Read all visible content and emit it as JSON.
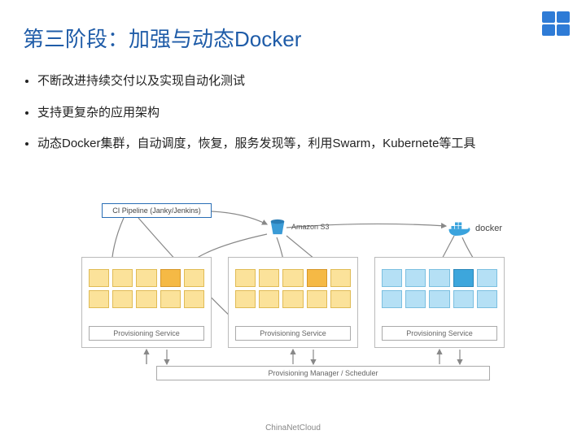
{
  "title": "第三阶段：加强与动态Docker",
  "bullets": [
    "不断改进持续交付以及实现自动化测试",
    "支持更复杂的应用架构",
    "动态Docker集群，自动调度，恢复，服务发现等，利用Swarm，Kubernete等工具"
  ],
  "diagram": {
    "ci_pipeline": "CI Pipeline (Janky/Jenkins)",
    "s3_label": "Amazon S3",
    "docker_label": "docker",
    "provisioning_service": "Provisioning Service",
    "scheduler": "Provisioning Manager / Scheduler"
  },
  "footer": "ChinaNetCloud"
}
